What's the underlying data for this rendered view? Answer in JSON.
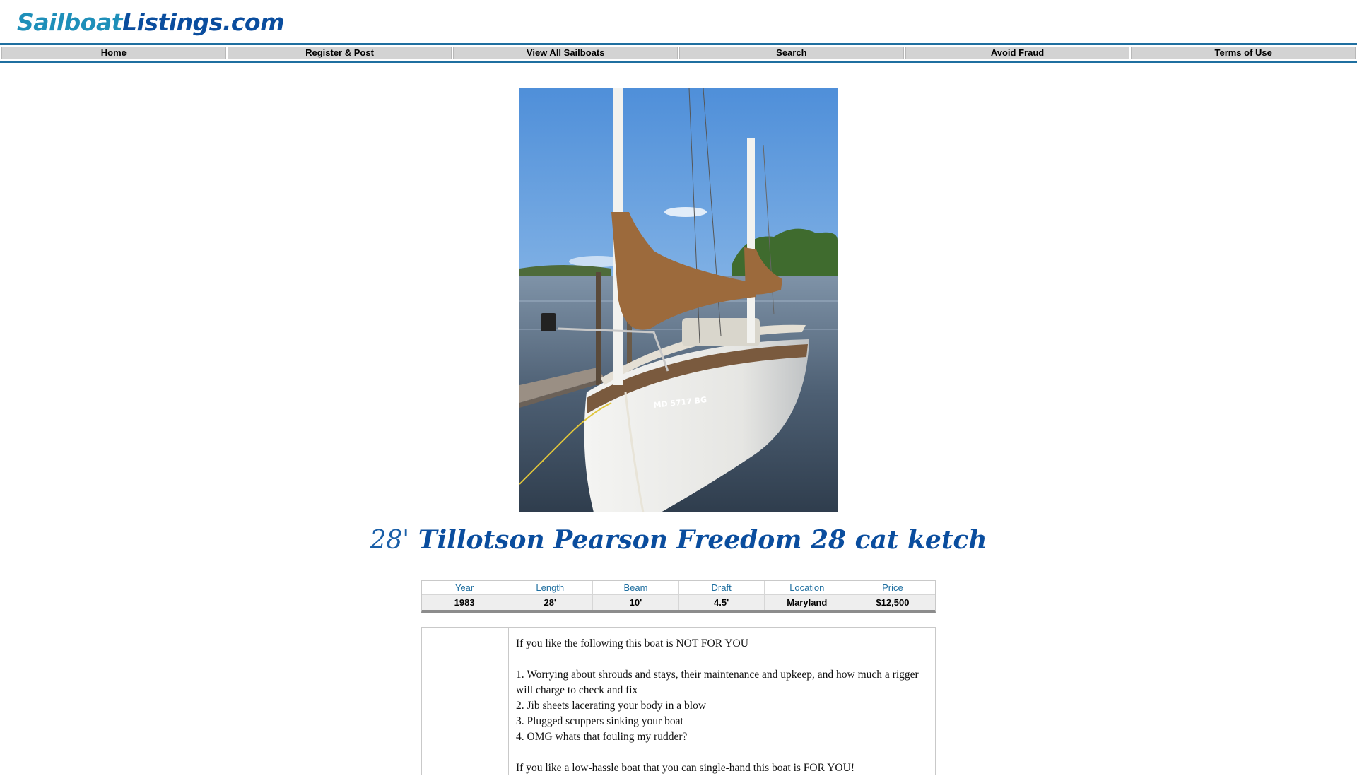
{
  "site": {
    "logo_part1": "Sailboat",
    "logo_part2": "Listings",
    "logo_part3": ".com"
  },
  "nav": {
    "items": [
      {
        "label": "Home"
      },
      {
        "label": "Register & Post"
      },
      {
        "label": "View All Sailboats"
      },
      {
        "label": "Search"
      },
      {
        "label": "Avoid Fraud"
      },
      {
        "label": "Terms of Use"
      }
    ]
  },
  "listing": {
    "length_prefix": "28'",
    "title": "Tillotson Pearson Freedom 28 cat ketch",
    "photo_registration": "MD 5717 BG"
  },
  "specs": {
    "headers": [
      "Year",
      "Length",
      "Beam",
      "Draft",
      "Location",
      "Price"
    ],
    "values": [
      "1983",
      "28'",
      "10'",
      "4.5'",
      "Maryland",
      "$12,500"
    ]
  },
  "description": {
    "intro": "If you like the following this boat is NOT FOR YOU",
    "items": [
      "1. Worrying about shrouds and stays, their maintenance and upkeep, and how much a rigger will charge to check and fix",
      "2. Jib sheets lacerating your body in a blow",
      "3. Plugged scuppers sinking your boat",
      "4. OMG whats that fouling my rudder?"
    ],
    "outro": "If you like a low-hassle boat that you can single-hand this boat is FOR YOU!"
  },
  "colors": {
    "brand_blue": "#0a4d9e",
    "brand_light": "#1e8fb9",
    "nav_border": "#1f6fa0",
    "nav_bg": "#d3d3d3"
  }
}
